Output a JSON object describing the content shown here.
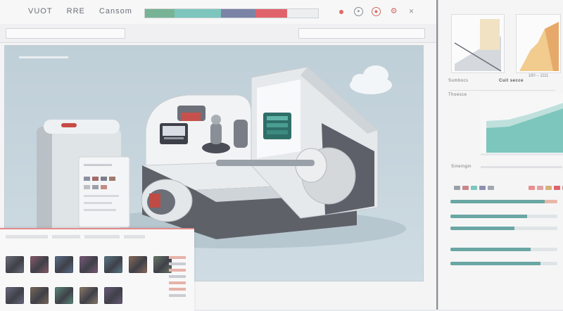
{
  "window": {
    "title_parts": [
      "VUOT",
      "RRE",
      "Cansom"
    ]
  },
  "progress": {
    "segments": [
      {
        "color": "#77b394",
        "fraction": 0.17
      },
      {
        "color": "#7cc6bd",
        "fraction": 0.27
      },
      {
        "color": "#7b83a7",
        "fraction": 0.2
      },
      {
        "color": "#e0636b",
        "fraction": 0.18
      },
      {
        "color": "#eceef0",
        "fraction": 0.18
      }
    ]
  },
  "window_controls": [
    {
      "name": "minimize",
      "icon": "dot-icon"
    },
    {
      "name": "target",
      "icon": "target-icon"
    },
    {
      "name": "record",
      "icon": "record-icon"
    },
    {
      "name": "settings",
      "icon": "gear-icon"
    },
    {
      "name": "close",
      "icon": "close-icon"
    }
  ],
  "right_panel": {
    "chart_captions": [
      "",
      "160 ‒ 1111"
    ],
    "section_a": "Sumbocs",
    "section_a_value": "Cuit secce",
    "section_b": "Thoesce",
    "section_c": "Sinemgin",
    "stats": [
      {
        "value": 0.88
      },
      {
        "value": 0.72
      },
      {
        "value": 0.6
      },
      {
        "value": 0.75
      },
      {
        "value": 0.84
      }
    ]
  },
  "colors": {
    "accent_teal": "#6aa6a3",
    "accent_red": "#e0636b",
    "viewport_bg": "#c4d3db"
  },
  "thumbnails": {
    "colors": [
      "#6c6f7a",
      "#8a5a6a",
      "#5a6f8a",
      "#7a5a7a",
      "#5a7a8a",
      "#8a6a5a",
      "#6a7a6a",
      "#6a6a80",
      "#7a6a5a",
      "#5a8a7a",
      "#8a7a6a",
      "#6a5a7a",
      "#7a7a8a",
      "#6a8a8a"
    ]
  }
}
